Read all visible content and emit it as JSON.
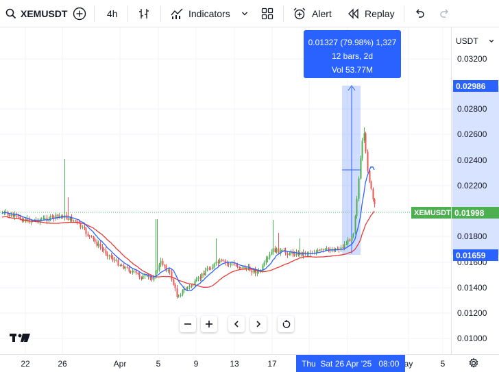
{
  "toolbar": {
    "symbol": "XEMUSDT",
    "interval": "4h",
    "indicators_label": "Indicators",
    "alert_label": "Alert",
    "replay_label": "Replay"
  },
  "price_axis": {
    "currency": "USDT",
    "labels": [
      "0.03200",
      "0.02800",
      "0.02600",
      "0.02400",
      "0.02200",
      "0.01800",
      "0.01600",
      "0.01400",
      "0.01200",
      "0.01000"
    ],
    "upper_tag": "0.02986",
    "lower_tag": "0.01659",
    "last_price": "0.01998",
    "last_symbol": "XEMUSDT"
  },
  "time_axis": {
    "labels": [
      "22",
      "26",
      "Apr",
      "5",
      "9",
      "13",
      "17",
      "ay",
      "5"
    ],
    "crosshair_label": "Thu  Sat 26 Apr '25   08:00"
  },
  "measure": {
    "line1": "0.01327 (79.98%) 1,327",
    "line2": "12 bars, 2d",
    "line3": "Vol 53.77M"
  },
  "colors": {
    "up": "#26a69a",
    "up_candle": "#4caf50",
    "down": "#ef5350",
    "accent": "#2962ff",
    "ma_fast": "#2962ff",
    "ma_slow": "#e53935",
    "last_price_bg": "#4caf50"
  }
}
